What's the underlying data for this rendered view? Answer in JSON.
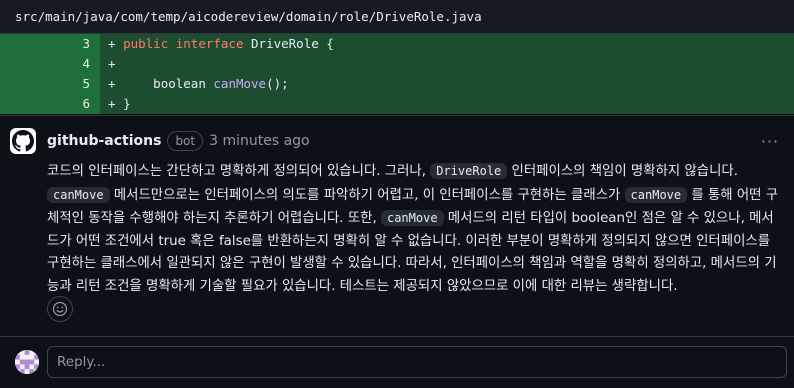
{
  "file": {
    "path": "src/main/java/com/temp/aicodereview/domain/role/DriveRole.java"
  },
  "diff": {
    "lines": [
      {
        "num": "3",
        "sign": "+",
        "kw1": "public",
        "kw2": "interface",
        "name": "DriveRole {"
      },
      {
        "num": "4",
        "sign": "+"
      },
      {
        "num": "5",
        "sign": "+",
        "type": "boolean",
        "method": "canMove",
        "rest": "();"
      },
      {
        "num": "6",
        "sign": "+",
        "text": "}"
      }
    ]
  },
  "comment": {
    "author": "github-actions",
    "badge": "bot",
    "time": "3 minutes ago",
    "more_label": "···",
    "body": {
      "t1": "코드의 인터페이스는 간단하고 명확하게 정의되어 있습니다. 그러나, ",
      "c1": "DriveRole",
      "t2": " 인터페이스의 책임이 명확하지 않습니다. ",
      "c2": "canMove",
      "t3": " 메서드만으로는 인터페이스의 의도를 파악하기 어렵고, 이 인터페이스를 구현하는 클래스가 ",
      "c3": "canMove",
      "t4": " 를 통해 어떤 구체적인 동작을 수행해야 하는지 추론하기 어렵습니다. 또한, ",
      "c4": "canMove",
      "t5": " 메서드의 리턴 타입이 boolean인 점은 알 수 있으나, 메서드가 어떤 조건에서 true 혹은 false를 반환하는지 명확히 알 수 없습니다. 이러한 부분이 명확하게 정의되지 않으면 인터페이스를 구현하는 클래스에서 일관되지 않은 구현이 발생할 수 있습니다. 따라서, 인터페이스의 책임과 역할을 명확히 정의하고, 메서드의 기능과 리턴 조건을 명확하게 기술할 필요가 있습니다. 테스트는 제공되지 않았으므로 이에 대한 리뷰는 생략합니다."
    }
  },
  "reply": {
    "placeholder": "Reply..."
  }
}
